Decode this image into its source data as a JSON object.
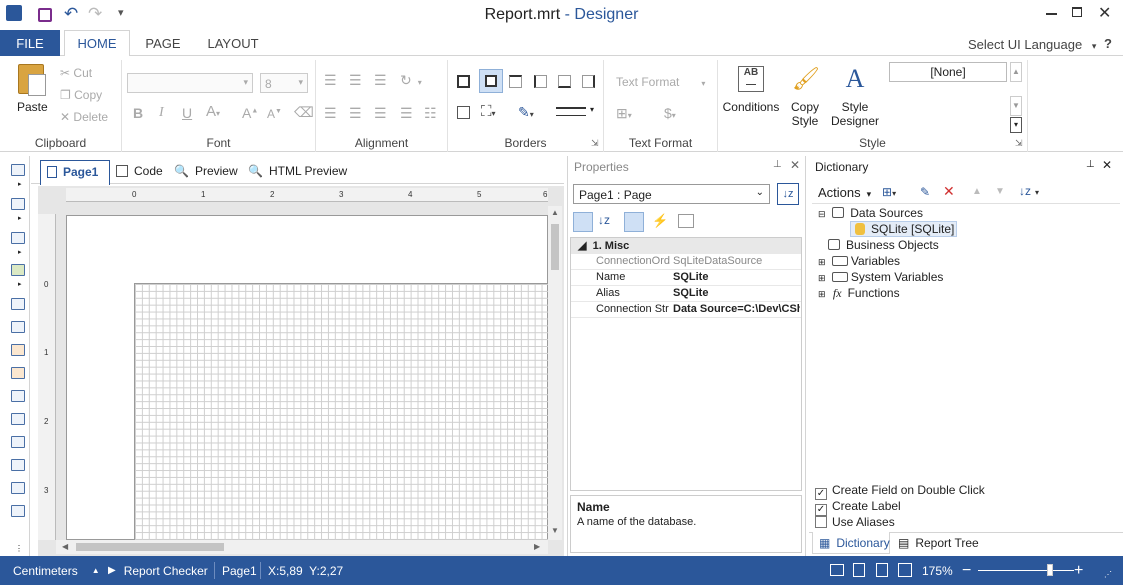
{
  "window": {
    "title_file": "Report.mrt",
    "title_app": "- Designer"
  },
  "tabs": {
    "file": "FILE",
    "home": "HOME",
    "page": "PAGE",
    "layout": "LAYOUT",
    "ui_language": "Select UI Language",
    "help": "?"
  },
  "ribbon": {
    "clipboard": {
      "label": "Clipboard",
      "paste": "Paste",
      "cut": "Cut",
      "copy": "Copy",
      "delete": "Delete"
    },
    "font": {
      "label": "Font",
      "size": "8"
    },
    "alignment": {
      "label": "Alignment"
    },
    "borders": {
      "label": "Borders"
    },
    "text_format": {
      "label": "Text Format",
      "combo": "Text Format"
    },
    "style": {
      "label": "Style",
      "conditions": "Conditions",
      "copy_style_1": "Copy",
      "copy_style_2": "Style",
      "style_designer_1": "Style",
      "style_designer_2": "Designer",
      "style_value": "[None]"
    }
  },
  "doc_tabs": {
    "page1": "Page1",
    "code": "Code",
    "preview": "Preview",
    "html_preview": "HTML Preview"
  },
  "ruler": {
    "h": [
      "0",
      "1",
      "2",
      "3",
      "4",
      "5",
      "6"
    ],
    "v": [
      "0",
      "1",
      "2",
      "3"
    ]
  },
  "properties": {
    "title": "Properties",
    "object": "Page1 : Page",
    "category": "1. Misc",
    "rows": [
      {
        "key": "ConnectionOrd",
        "value": "SqLiteDataSource"
      },
      {
        "key": "Name",
        "value": "SQLite"
      },
      {
        "key": "Alias",
        "value": "SQLite"
      },
      {
        "key": "Connection Str",
        "value": "Data Source=C:\\Dev\\CSh"
      }
    ],
    "desc_title": "Name",
    "desc_text": "A name of the database."
  },
  "dictionary": {
    "title": "Dictionary",
    "actions": "Actions",
    "tree": {
      "data_sources": "Data Sources",
      "sqlite": "SQLite [SQLite]",
      "business_objects": "Business Objects",
      "variables": "Variables",
      "system_variables": "System Variables",
      "functions": "Functions"
    },
    "options": [
      {
        "label": "Create Field on Double Click",
        "checked": true
      },
      {
        "label": "Create Label",
        "checked": true
      },
      {
        "label": "Use Aliases",
        "checked": false
      }
    ],
    "tab_dictionary": "Dictionary",
    "tab_report_tree": "Report Tree"
  },
  "status": {
    "units": "Centimeters",
    "checker": "Report Checker",
    "page": "Page1",
    "coords": "X:5,89  Y:2,27",
    "zoom": "175%",
    "zoom_level_pct": 0.75
  },
  "colors": {
    "accent": "#2b579a",
    "grid": "#c8c8c8"
  }
}
